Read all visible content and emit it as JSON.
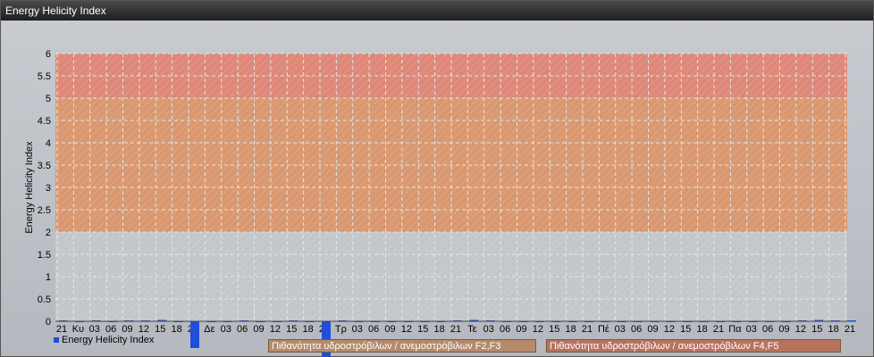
{
  "window": {
    "title": "Energy Helicity Index"
  },
  "colors": {
    "band_low": "#d99870",
    "band_high": "#de8878",
    "bar": "#1f4fd6",
    "plot_bg": "#c3c6cb",
    "grid": "#e4e6ea"
  },
  "legend": {
    "series_label": "Energy Helicity Index"
  },
  "bands": [
    {
      "label": "Πιθανότητα υδροστρόβιλων / ανεμοστρόβιλων F2,F3",
      "from": 2,
      "to": 5,
      "color": "#d99870"
    },
    {
      "label": "Πιθανότητα υδροστρόβιλων / ανεμοστρόβιλων F4,F5",
      "from": 5,
      "to": 6,
      "color": "#de8878"
    }
  ],
  "chart_data": {
    "type": "bar",
    "title": "Energy Helicity Index",
    "ylabel": "Energy Helicity Index",
    "xlabel": "",
    "ylim": [
      0,
      6
    ],
    "yticks": [
      "0",
      "0.5",
      "1",
      "1.5",
      "2",
      "2.5",
      "3",
      "3.5",
      "4",
      "4.5",
      "5",
      "5.5",
      "6"
    ],
    "grid": true,
    "legend_position": "bottom-left",
    "categories": [
      "21",
      "Κυ",
      "03",
      "06",
      "09",
      "12",
      "15",
      "18",
      "21",
      "Δε",
      "03",
      "06",
      "09",
      "12",
      "15",
      "18",
      "21",
      "Τρ",
      "03",
      "06",
      "09",
      "12",
      "15",
      "18",
      "21",
      "Τε",
      "03",
      "06",
      "09",
      "12",
      "15",
      "18",
      "21",
      "Πέ",
      "03",
      "06",
      "09",
      "12",
      "15",
      "18",
      "21",
      "Πα",
      "03",
      "06",
      "09",
      "12",
      "15",
      "18",
      "21"
    ],
    "series": [
      {
        "name": "Energy Helicity Index",
        "values": [
          0.02,
          0.01,
          0.02,
          0.01,
          0.02,
          0.02,
          0.03,
          0.01,
          -0.6,
          0.01,
          0.01,
          0.02,
          0.01,
          0.01,
          0.02,
          0.01,
          -1.1,
          0.02,
          0.01,
          0.01,
          0.01,
          0.01,
          0.01,
          0.01,
          0.02,
          0.03,
          0.02,
          0.01,
          0.01,
          0.01,
          0.01,
          0.01,
          0.01,
          0.01,
          0.01,
          0.01,
          0.01,
          0.01,
          0.01,
          0.01,
          0.01,
          0.01,
          0.01,
          0.01,
          0.01,
          0.02,
          0.03,
          0.02,
          0.02
        ]
      }
    ]
  }
}
